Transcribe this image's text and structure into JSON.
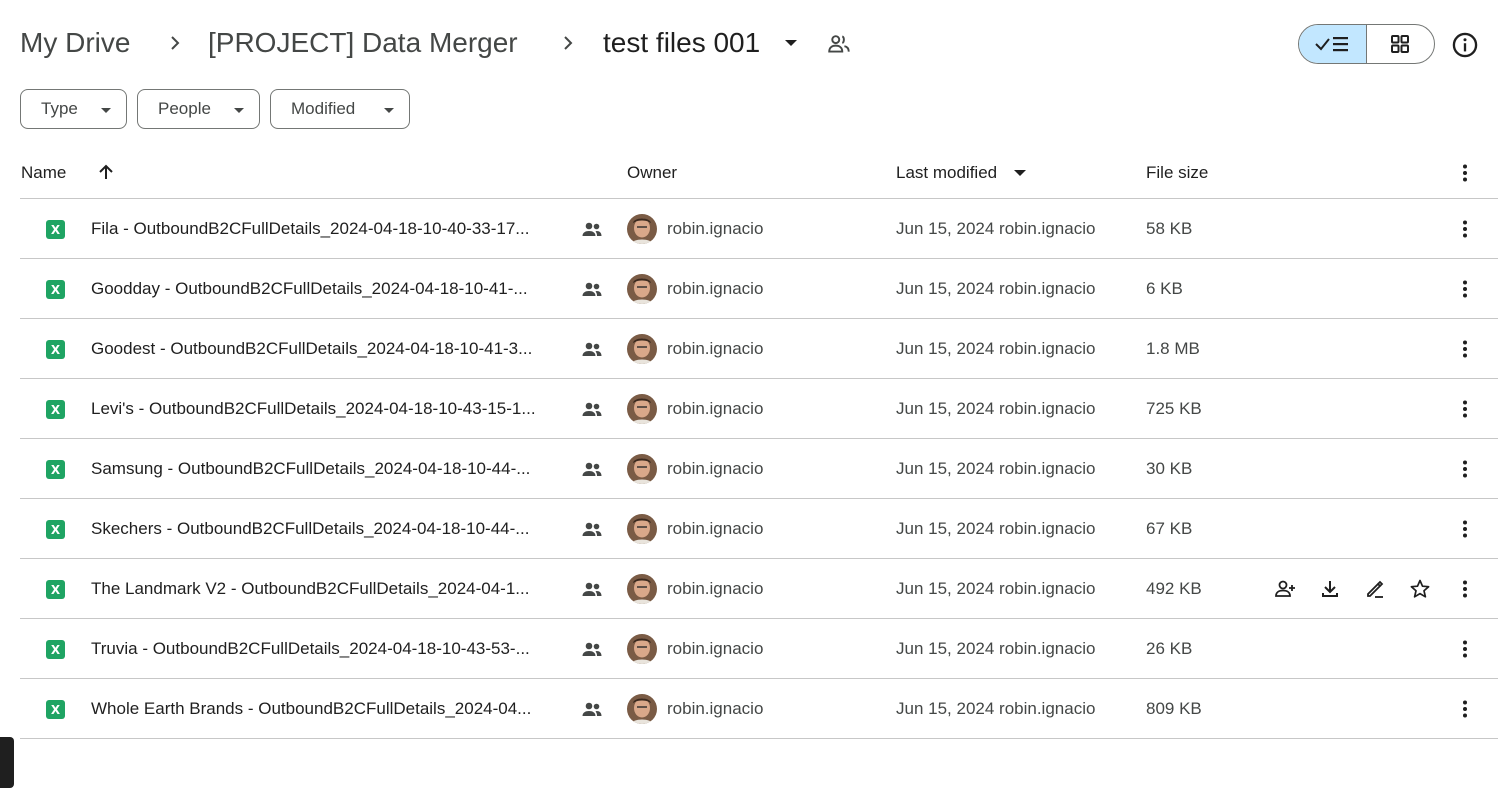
{
  "breadcrumb": {
    "root": "My Drive",
    "parent": "[PROJECT] Data Merger",
    "current": "test files 001"
  },
  "view": {
    "mode": "list"
  },
  "filters": [
    {
      "label": "Type"
    },
    {
      "label": "People"
    },
    {
      "label": "Modified"
    }
  ],
  "columns": {
    "name": "Name",
    "owner": "Owner",
    "last_modified": "Last modified",
    "file_size": "File size"
  },
  "colors": {
    "xls_icon": "#1fa463",
    "view_toggle_active": "#c2e7ff"
  },
  "files": [
    {
      "name": "Fila - OutboundB2CFullDetails_2024-04-18-10-40-33-17...",
      "owner": "robin.ignacio",
      "modified": "Jun 15, 2024  robin.ignacio",
      "size": "58 KB"
    },
    {
      "name": "Goodday - OutboundB2CFullDetails_2024-04-18-10-41-...",
      "owner": "robin.ignacio",
      "modified": "Jun 15, 2024  robin.ignacio",
      "size": "6 KB"
    },
    {
      "name": "Goodest - OutboundB2CFullDetails_2024-04-18-10-41-3...",
      "owner": "robin.ignacio",
      "modified": "Jun 15, 2024  robin.ignacio",
      "size": "1.8 MB"
    },
    {
      "name": "Levi's - OutboundB2CFullDetails_2024-04-18-10-43-15-1...",
      "owner": "robin.ignacio",
      "modified": "Jun 15, 2024  robin.ignacio",
      "size": "725 KB"
    },
    {
      "name": "Samsung - OutboundB2CFullDetails_2024-04-18-10-44-...",
      "owner": "robin.ignacio",
      "modified": "Jun 15, 2024  robin.ignacio",
      "size": "30 KB"
    },
    {
      "name": "Skechers - OutboundB2CFullDetails_2024-04-18-10-44-...",
      "owner": "robin.ignacio",
      "modified": "Jun 15, 2024  robin.ignacio",
      "size": "67 KB"
    },
    {
      "name": "The Landmark V2 - OutboundB2CFullDetails_2024-04-1...",
      "owner": "robin.ignacio",
      "modified": "Jun 15, 2024  robin.ignacio",
      "size": "492 KB",
      "hovered": true
    },
    {
      "name": "Truvia - OutboundB2CFullDetails_2024-04-18-10-43-53-...",
      "owner": "robin.ignacio",
      "modified": "Jun 15, 2024  robin.ignacio",
      "size": "26 KB"
    },
    {
      "name": "Whole Earth Brands - OutboundB2CFullDetails_2024-04...",
      "owner": "robin.ignacio",
      "modified": "Jun 15, 2024  robin.ignacio",
      "size": "809 KB"
    }
  ],
  "icons": {
    "file_type": "excel-icon",
    "shared": "shared-people-icon",
    "row_actions": [
      "add-person-icon",
      "download-icon",
      "rename-icon",
      "star-icon"
    ],
    "more": "more-vert-icon"
  }
}
